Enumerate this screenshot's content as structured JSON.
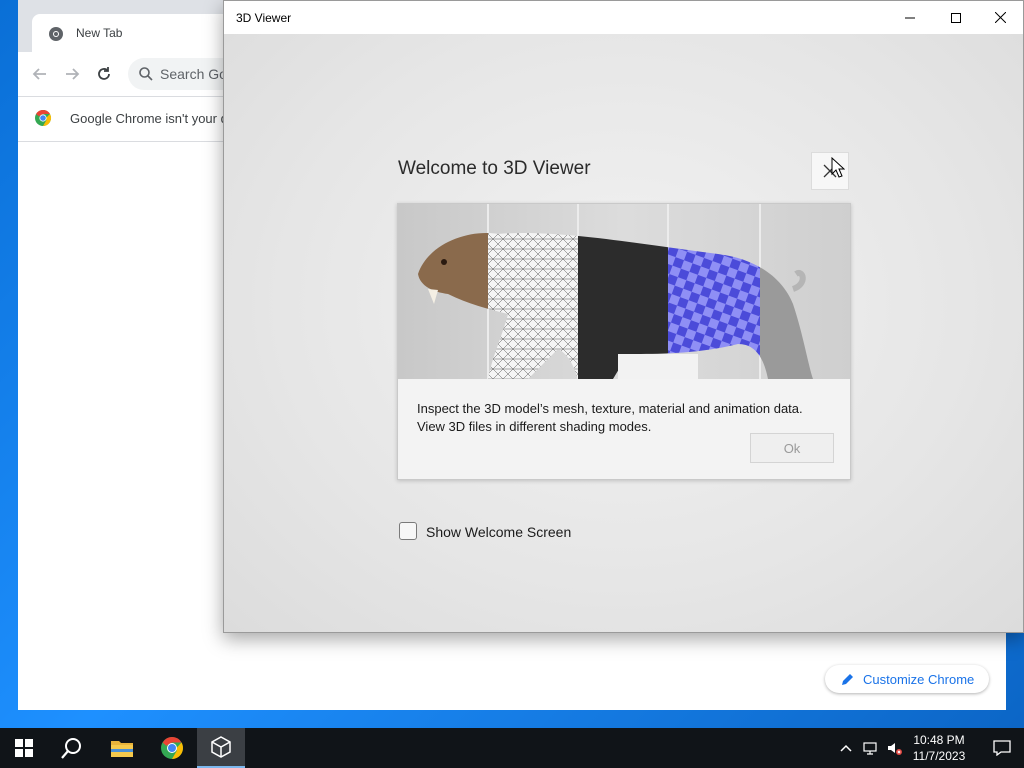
{
  "chrome": {
    "tab_title": "New Tab",
    "omnibox_placeholder": "Search Google or type a URL",
    "infobar_text": "Google Chrome isn't your default browser",
    "customize_label": "Customize Chrome"
  },
  "viewer": {
    "window_title": "3D Viewer",
    "welcome_title": "Welcome to 3D Viewer",
    "description_line1": "Inspect the 3D model’s mesh, texture, material and animation data.",
    "description_line2": "View 3D files in different shading modes.",
    "ok_label": "Ok",
    "checkbox_label": "Show Welcome Screen",
    "checkbox_checked": false
  },
  "taskbar": {
    "time": "10:48 PM",
    "date": "11/7/2023"
  },
  "colors": {
    "accent_blue": "#1a73e8",
    "checker_blue": "#7a7af0",
    "desktop_blue": "#1e90ff"
  }
}
